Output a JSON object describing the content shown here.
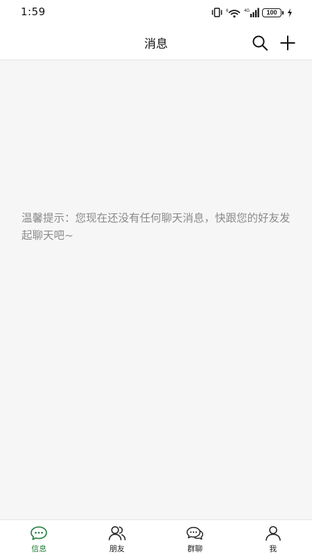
{
  "status_bar": {
    "time": "1:59",
    "battery": "100",
    "network": "4G"
  },
  "nav": {
    "title": "消息",
    "icons": {
      "search": "search-icon",
      "add": "plus-icon"
    }
  },
  "empty_state": {
    "text": "温馨提示：您现在还没有任何聊天消息，快跟您的好友发起聊天吧~"
  },
  "tabs": [
    {
      "label": "信息",
      "icon": "chat-bubble-icon",
      "active": true
    },
    {
      "label": "朋友",
      "icon": "friends-icon",
      "active": false
    },
    {
      "label": "群聊",
      "icon": "group-chat-icon",
      "active": false
    },
    {
      "label": "我",
      "icon": "profile-icon",
      "active": false
    }
  ],
  "colors": {
    "accent": "#1f7a3a",
    "background": "#f6f6f6",
    "tip_text": "#8a8a8a"
  }
}
